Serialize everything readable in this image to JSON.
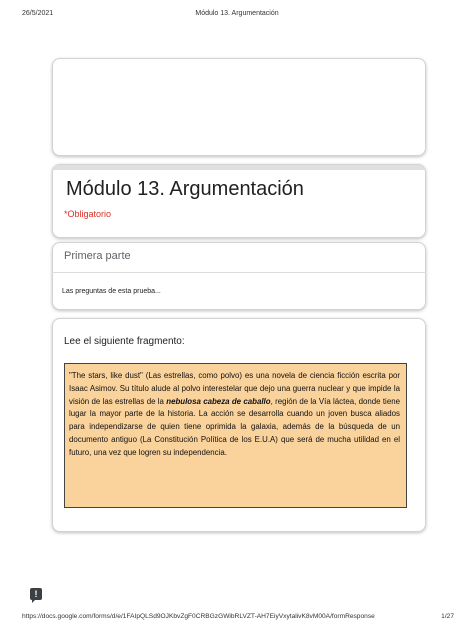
{
  "print_header": {
    "date": "26/5/2021",
    "title": "Módulo 13. Argumentación"
  },
  "form": {
    "title": "Módulo 13. Argumentación",
    "required_note": "*Obligatorio"
  },
  "section": {
    "heading": "Primera parte",
    "description": "Las preguntas de esta prueba..."
  },
  "question": {
    "title": "Lee el siguiente fragmento:",
    "passage": {
      "part1": "\"The stars, like dust\" (Las estrellas, como polvo) es una novela de ciencia ficción escrita por Isaac Asimov. Su título alude al polvo interestelar que dejo una guerra nuclear y que impide la visión de las estrellas de la ",
      "emphasis": "nebulosa cabeza de caballo",
      "part2": ", región de la Vía láctea, donde tiene lugar la mayor parte de la historia. La acción se desarrolla cuando un joven busca aliados para independizarse de quien tiene oprimida la galaxia, además de la búsqueda de un documento antiguo (La Constitución Política de los E.U.A) que será de mucha utilidad en el futuro, una vez que logren su independencia."
    },
    "passage_background": "#fad29c"
  },
  "report_icon": {
    "icon": "report-problem-icon",
    "glyph": "!"
  },
  "print_footer": {
    "url": "https://docs.google.com/forms/d/e/1FAIpQLSd9OJKbvZgF0CRBGzGWibRLVZT-AH7EiyVxytalivK8vM00A/formResponse",
    "page": "1/27"
  }
}
